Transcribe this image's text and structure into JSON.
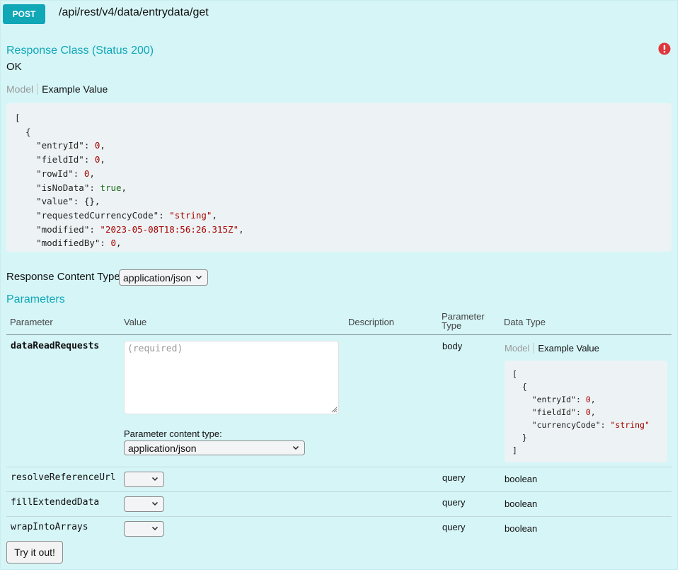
{
  "endpoint": {
    "method": "POST",
    "path": "/api/rest/v4/data/entrydata/get"
  },
  "response": {
    "title": "Response Class (Status 200)",
    "status_text": "OK",
    "tab_model": "Model",
    "tab_example": "Example Value",
    "example_lines": [
      [
        {
          "t": "p",
          "v": "["
        }
      ],
      [
        {
          "t": "p",
          "v": "  {"
        }
      ],
      [
        {
          "t": "p",
          "v": "    \"entryId\": "
        },
        {
          "t": "num",
          "v": "0"
        },
        {
          "t": "p",
          "v": ","
        }
      ],
      [
        {
          "t": "p",
          "v": "    \"fieldId\": "
        },
        {
          "t": "num",
          "v": "0"
        },
        {
          "t": "p",
          "v": ","
        }
      ],
      [
        {
          "t": "p",
          "v": "    \"rowId\": "
        },
        {
          "t": "num",
          "v": "0"
        },
        {
          "t": "p",
          "v": ","
        }
      ],
      [
        {
          "t": "p",
          "v": "    \"isNoData\": "
        },
        {
          "t": "bool",
          "v": "true"
        },
        {
          "t": "p",
          "v": ","
        }
      ],
      [
        {
          "t": "p",
          "v": "    \"value\": {},"
        }
      ],
      [
        {
          "t": "p",
          "v": "    \"requestedCurrencyCode\": "
        },
        {
          "t": "str",
          "v": "\"string\""
        },
        {
          "t": "p",
          "v": ","
        }
      ],
      [
        {
          "t": "p",
          "v": "    \"modified\": "
        },
        {
          "t": "str",
          "v": "\"2023-05-08T18:56:26.315Z\""
        },
        {
          "t": "p",
          "v": ","
        }
      ],
      [
        {
          "t": "p",
          "v": "    \"modifiedBy\": "
        },
        {
          "t": "num",
          "v": "0"
        },
        {
          "t": "p",
          "v": ","
        }
      ]
    ]
  },
  "response_content_type": {
    "label": "Response Content Type",
    "selected": "application/json"
  },
  "parameters": {
    "title": "Parameters",
    "headers": {
      "parameter": "Parameter",
      "value": "Value",
      "description": "Description",
      "parameter_type_line1": "Parameter",
      "parameter_type_line2": "Type",
      "data_type": "Data Type"
    },
    "body_param": {
      "name": "dataReadRequests",
      "placeholder": "(required)",
      "content_type_label": "Parameter content type:",
      "content_type_selected": "application/json",
      "param_type": "body",
      "tab_model": "Model",
      "tab_example": "Example Value",
      "example_lines": [
        [
          {
            "t": "p",
            "v": "["
          }
        ],
        [
          {
            "t": "p",
            "v": "  {"
          }
        ],
        [
          {
            "t": "p",
            "v": "    \"entryId\": "
          },
          {
            "t": "num",
            "v": "0"
          },
          {
            "t": "p",
            "v": ","
          }
        ],
        [
          {
            "t": "p",
            "v": "    \"fieldId\": "
          },
          {
            "t": "num",
            "v": "0"
          },
          {
            "t": "p",
            "v": ","
          }
        ],
        [
          {
            "t": "p",
            "v": "    \"currencyCode\": "
          },
          {
            "t": "str",
            "v": "\"string\""
          }
        ],
        [
          {
            "t": "p",
            "v": "  }"
          }
        ],
        [
          {
            "t": "p",
            "v": "]"
          }
        ]
      ]
    },
    "rows": [
      {
        "name": "resolveReferenceUrl",
        "value": "",
        "param_type": "query",
        "data_type": "boolean"
      },
      {
        "name": "fillExtendedData",
        "value": "",
        "param_type": "query",
        "data_type": "boolean"
      },
      {
        "name": "wrapIntoArrays",
        "value": "",
        "param_type": "query",
        "data_type": "boolean"
      }
    ]
  },
  "try_button": "Try it out!",
  "icons": {
    "error": "exclamation-circle-icon",
    "error_color": "#e0363c",
    "accent_color": "#10a7b7"
  }
}
